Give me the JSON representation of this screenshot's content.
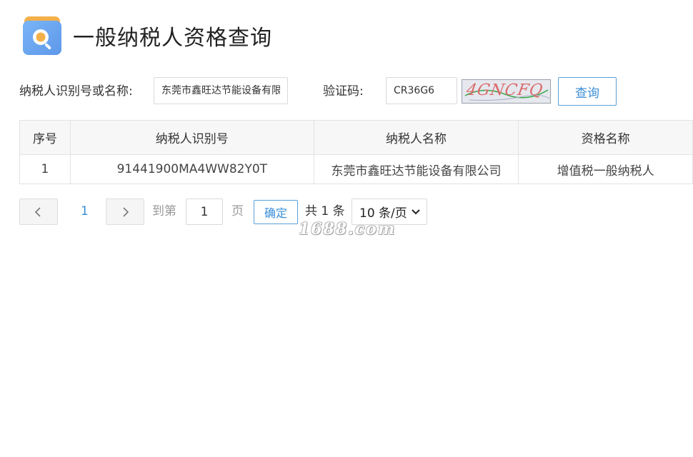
{
  "header": {
    "title": "一般纳税人资格查询",
    "logo_icon": "search-document-icon",
    "logo_colors": {
      "book": "#6aa8f2",
      "page": "#f3b04a",
      "magnifier": "#ffffff"
    }
  },
  "search": {
    "taxpayer_label": "纳税人识别号或名称:",
    "taxpayer_value": "东莞市鑫旺达节能设备有限公司",
    "captcha_label": "验证码:",
    "captcha_value": "CR36G6",
    "captcha_image_text": "4GNCFQ",
    "query_button": "查询"
  },
  "table": {
    "headers": [
      "序号",
      "纳税人识别号",
      "纳税人名称",
      "资格名称"
    ],
    "rows": [
      [
        "1",
        "91441900MA4WW82Y0T",
        "东莞市鑫旺达节能设备有限公司",
        "增值税一般纳税人"
      ]
    ]
  },
  "pagination": {
    "prev_icon": "chevron-left-icon",
    "current_page": "1",
    "next_icon": "chevron-right-icon",
    "goto_label": "到第",
    "goto_value": "1",
    "page_unit": "页",
    "confirm_button": "确定",
    "total_text": "共 1 条",
    "page_size": "10 条/页"
  },
  "watermark": "1688.com",
  "colors": {
    "accent": "#3a8ed6",
    "border": "#e3e3e3",
    "header_bg": "#f7f7f7"
  }
}
